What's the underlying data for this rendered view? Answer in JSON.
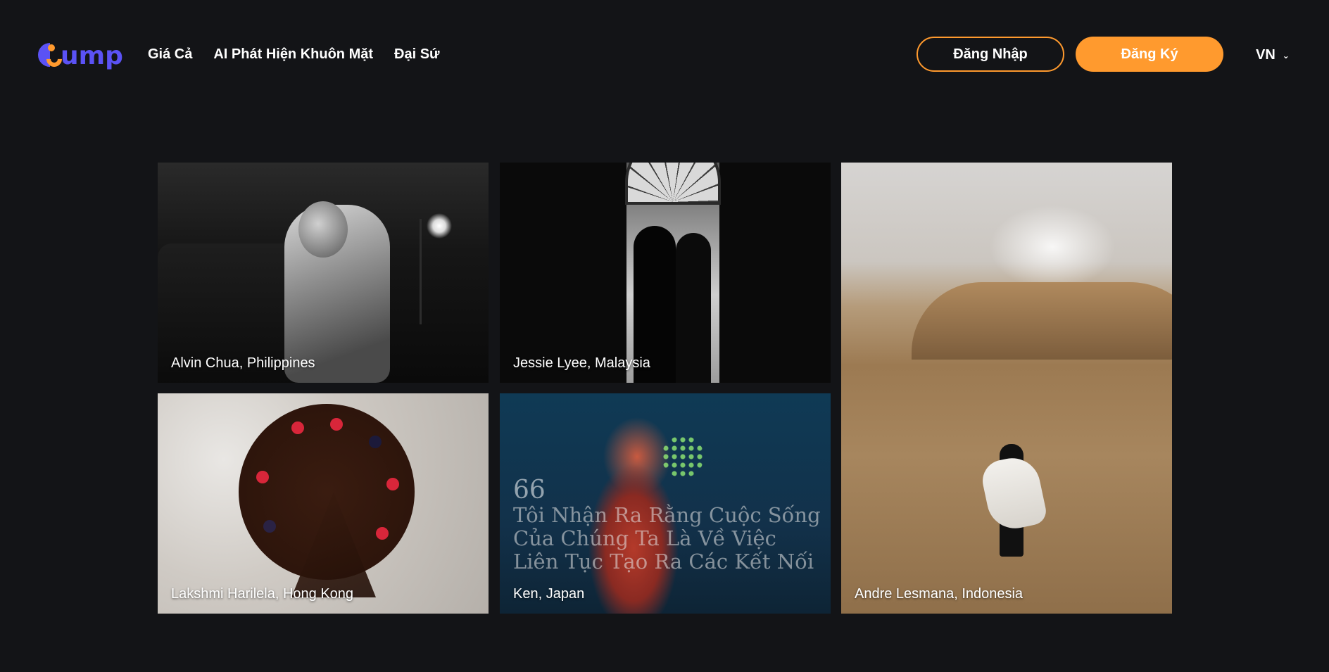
{
  "header": {
    "logo_text": "ump",
    "nav": [
      {
        "label": "Giá Cả"
      },
      {
        "label": "AI Phát Hiện Khuôn Mặt"
      },
      {
        "label": "Đại Sứ"
      }
    ],
    "login_label": "Đăng Nhập",
    "signup_label": "Đăng Ký",
    "language": "VN"
  },
  "gallery": {
    "tiles": [
      {
        "caption": "Alvin Chua, Philippines"
      },
      {
        "caption": "Jessie Lyee, Malaysia"
      },
      {
        "caption": "Andre Lesmana, Indonesia"
      },
      {
        "caption": "Lakshmi Harilela, Hong Kong"
      },
      {
        "caption": "Ken, Japan",
        "quote_mark": "66",
        "quote": "Tôi Nhận Ra Rằng Cuộc Sống Của Chúng Ta Là Về Việc Liên Tục Tạo Ra Các Kết Nối"
      }
    ]
  },
  "colors": {
    "background": "#131417",
    "brand_blue": "#5b52f5",
    "accent_orange": "#ff9a2e",
    "text": "#ffffff"
  },
  "icons": {
    "logo": "gump-logo",
    "language_dropdown": "chevron-down-icon"
  }
}
